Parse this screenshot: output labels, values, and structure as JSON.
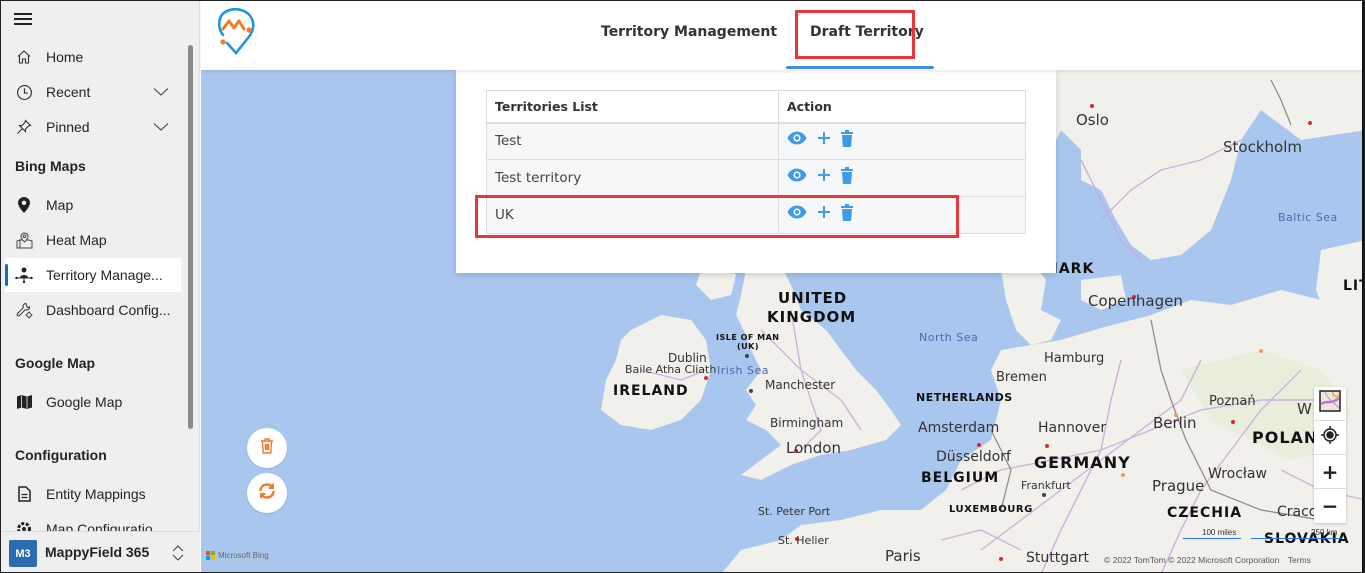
{
  "sidebar": {
    "nav": [
      {
        "label": "Home",
        "icon": "home-icon"
      },
      {
        "label": "Recent",
        "icon": "clock-icon",
        "expandable": true
      },
      {
        "label": "Pinned",
        "icon": "pin-icon",
        "expandable": true
      }
    ],
    "sections": [
      {
        "title": "Bing Maps",
        "items": [
          {
            "label": "Map",
            "icon": "map-marker-icon"
          },
          {
            "label": "Heat Map",
            "icon": "heat-map-icon"
          },
          {
            "label": "Territory Manage...",
            "icon": "territory-icon",
            "active": true
          },
          {
            "label": "Dashboard Config...",
            "icon": "wrench-gear-icon"
          }
        ]
      },
      {
        "title": "Google Map",
        "items": [
          {
            "label": "Google Map",
            "icon": "folded-map-icon"
          }
        ]
      },
      {
        "title": "Configuration",
        "items": [
          {
            "label": "Entity Mappings",
            "icon": "document-icon"
          },
          {
            "label": "Map Configuratio",
            "icon": "gear-icon"
          }
        ]
      }
    ],
    "app": {
      "badge": "M3",
      "name": "MappyField 365"
    }
  },
  "header": {
    "tabs": [
      {
        "label": "Territory Management",
        "active": false
      },
      {
        "label": "Draft Territory",
        "active": true
      }
    ]
  },
  "table": {
    "columns": [
      "Territories List",
      "Action"
    ],
    "rows": [
      {
        "name": "Test"
      },
      {
        "name": "Test territory"
      },
      {
        "name": "UK",
        "highlighted": true
      }
    ],
    "actions": [
      "view-icon",
      "add-icon",
      "delete-icon"
    ]
  },
  "map": {
    "labels": {
      "oslo": "Oslo",
      "stockholm": "Stockholm",
      "baltic": "Baltic Sea",
      "denmark": "DENMARK",
      "copenhagen": "Copenhagen",
      "lit": "LIT",
      "uk1": "UNITED",
      "uk2": "KINGDOM",
      "isle1": "ISLE OF MAN",
      "isle2": "(UK)",
      "dublin": "Dublin",
      "baile": "Baile Atha Cliath",
      "irish_sea": "Irish Sea",
      "ireland": "IRELAND",
      "manchester": "Manchester",
      "birmingham": "Birmingham",
      "london": "London",
      "north_sea": "North Sea",
      "hamburg": "Hamburg",
      "bremen": "Bremen",
      "netherlands": "NETHERLANDS",
      "amsterdam": "Amsterdam",
      "hannover": "Hannover",
      "berlin": "Berlin",
      "poznan": "Poznań",
      "polan": "POLAN",
      "warsaw": "W",
      "warsaw2": "w",
      "dusseldorf": "Düsseldorf",
      "germany": "GERMANY",
      "belgium": "BELGIUM",
      "frankfurt": "Frankfurt",
      "wroclaw": "Wrocław",
      "prague": "Prague",
      "luxembourg": "LUXEMBOURG",
      "czechia": "CZECHIA",
      "cracow": "Cracow",
      "slovakia": "SLOVAKIA",
      "st_peter": "St. Peter Port",
      "st_helier": "St. Helier",
      "paris": "Paris",
      "stuttgart": "Stuttgart"
    },
    "scale_miles": "100 miles",
    "scale_km": "250 km",
    "copyright": "© 2022 TomTom © 2022 Microsoft Corporation",
    "terms": "Terms",
    "provider": "Microsoft Bing",
    "controls": {
      "zoom_in": "+",
      "zoom_out": "−"
    }
  },
  "colors": {
    "accent": "#3b8fe8",
    "action_icon": "#3d9be9",
    "highlight": "#e8383d",
    "fab_icon": "#f07a2b",
    "water": "#a9c6ee",
    "land": "#f2f0ea"
  }
}
